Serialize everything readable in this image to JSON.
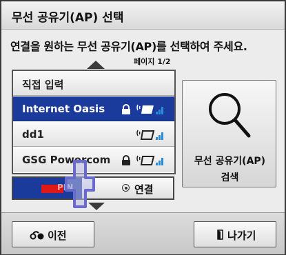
{
  "window": {
    "title": "무선 공유기(AP) 선택"
  },
  "instruction": "연결을 원하는 무선 공유기(AP)를 선택하여 주세요.",
  "page_indicator": "페이지 1/2",
  "ap_list": {
    "direct_entry_label": "직접 입력",
    "items": [
      {
        "name": "Internet Oasis",
        "secured": true,
        "selected": true,
        "signal": "strong"
      },
      {
        "name": "dd1",
        "secured": false,
        "selected": false,
        "signal": "strong"
      },
      {
        "name": "GSG Powercom",
        "secured": true,
        "selected": false,
        "signal": "strong"
      }
    ]
  },
  "search_button": {
    "line1": "무선 공유기(AP)",
    "line2": "검색"
  },
  "pin_option": {
    "label": "PIN",
    "connect_label": "연결"
  },
  "footer": {
    "prev_label": "이전",
    "exit_label": "나가기"
  },
  "colors": {
    "selection": "#1a3a9c",
    "pin_marker": "#e01818",
    "signal_bars": "#2a8bd8",
    "dialog_bg": "#ececec"
  }
}
